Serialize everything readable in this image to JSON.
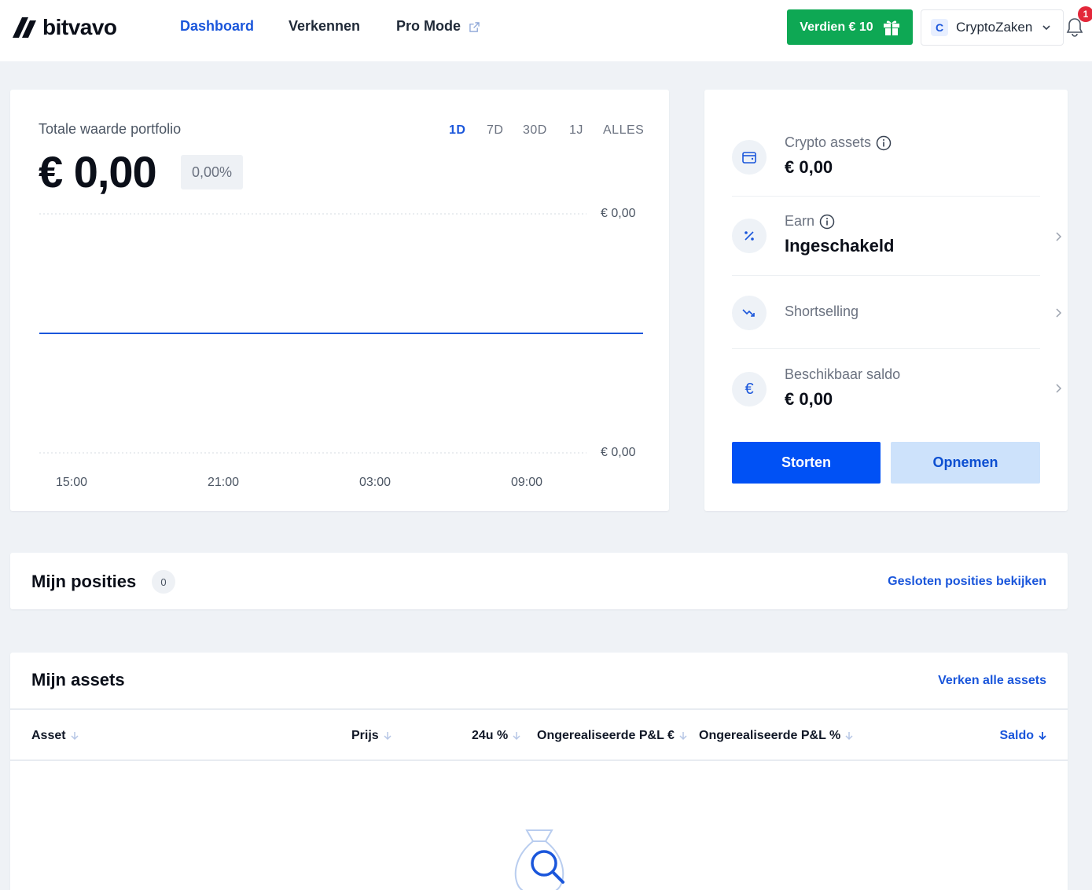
{
  "header": {
    "logo_text": "bitvavo",
    "nav": [
      {
        "label": "Dashboard",
        "active": true
      },
      {
        "label": "Verkennen",
        "active": false
      },
      {
        "label": "Pro Mode",
        "active": false
      }
    ],
    "earn_button": "Verdien € 10",
    "account": {
      "initial": "C",
      "name": "CryptoZaken"
    },
    "notification_count": "1"
  },
  "portfolio": {
    "label": "Totale waarde portfolio",
    "value": "€ 0,00",
    "change_pct": "0,00%",
    "ranges": [
      "1D",
      "7D",
      "30D",
      "1J",
      "ALLES"
    ],
    "active_range": "1D"
  },
  "chart_data": {
    "type": "line",
    "x_ticks": [
      "15:00",
      "21:00",
      "03:00",
      "09:00"
    ],
    "y_ticks": [
      "€ 0,00",
      "€ 0,00"
    ],
    "series": [
      {
        "values": [
          0,
          0
        ]
      }
    ],
    "ylim": [
      0,
      0
    ],
    "grid": "dashed horizontal",
    "line_color": "#1a56db"
  },
  "summary": {
    "crypto_assets": {
      "label": "Crypto assets",
      "value": "€ 0,00"
    },
    "earn": {
      "label": "Earn",
      "value": "Ingeschakeld"
    },
    "shortselling": {
      "label": "Shortselling"
    },
    "balance": {
      "label": "Beschikbaar saldo",
      "value": "€ 0,00"
    },
    "deposit": "Storten",
    "withdraw": "Opnemen"
  },
  "positions": {
    "title": "Mijn posities",
    "count": "0",
    "link": "Gesloten posities bekijken"
  },
  "assets": {
    "title": "Mijn assets",
    "link": "Verken alle assets",
    "columns": [
      "Asset",
      "Prijs",
      "24u %",
      "Ongerealiseerde P&L €",
      "Ongerealiseerde P&L %",
      "Saldo"
    ],
    "sorted_column": "Saldo"
  },
  "colors": {
    "brand_blue": "#1a56db",
    "primary_button": "#0051f5",
    "earn_green": "#0ea854",
    "notification_red": "#e3273a"
  }
}
